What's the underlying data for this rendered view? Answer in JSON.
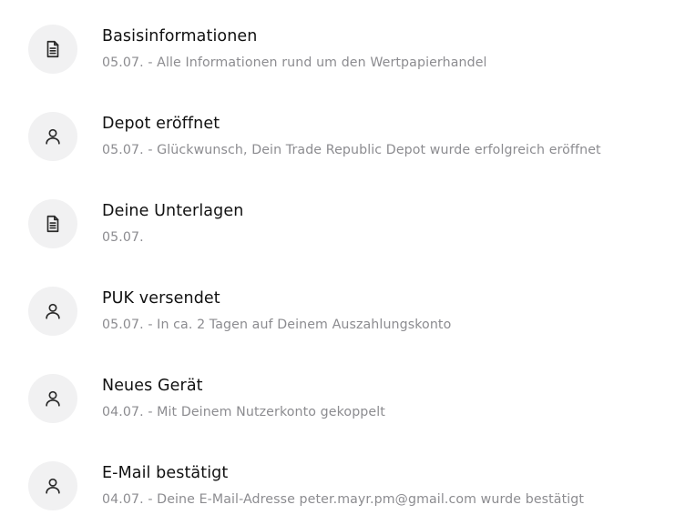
{
  "timeline": {
    "items": [
      {
        "icon": "document-icon",
        "title": "Basisinformationen",
        "subtitle": "05.07. - Alle Informationen rund um den Wertpapierhandel"
      },
      {
        "icon": "person-icon",
        "title": "Depot eröffnet",
        "subtitle": "05.07. - Glückwunsch, Dein Trade Republic Depot wurde erfolgreich eröffnet"
      },
      {
        "icon": "document-icon",
        "title": "Deine Unterlagen",
        "subtitle": "05.07."
      },
      {
        "icon": "person-icon",
        "title": "PUK versendet",
        "subtitle": "05.07. - In ca. 2 Tagen auf Deinem Auszahlungskonto"
      },
      {
        "icon": "person-icon",
        "title": "Neues Gerät",
        "subtitle": "04.07. - Mit Deinem Nutzerkonto gekoppelt"
      },
      {
        "icon": "person-icon",
        "title": "E-Mail bestätigt",
        "subtitle": "04.07. - Deine E-Mail-Adresse peter.mayr.pm@gmail.com wurde bestätigt"
      }
    ]
  },
  "colors": {
    "title": "#111111",
    "subtitle": "#8c8c90",
    "icon_background": "#f1f1f2",
    "icon_stroke": "#2a2a2a"
  }
}
